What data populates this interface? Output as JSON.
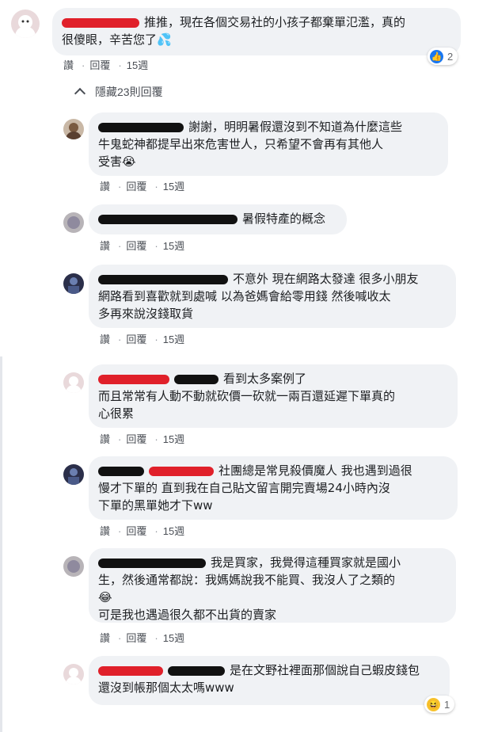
{
  "actions": {
    "like": "讚",
    "reply": "回覆",
    "sep": "·",
    "time": "15週"
  },
  "hidden_replies_label": "隱藏23則回覆",
  "comments": [
    {
      "text": "推推，現在各個交易社的小孩子都棄單氾濫，真的\n很傻眼，辛苦您了💦",
      "reaction_count": "2"
    },
    {
      "text": "謝謝，明明暑假還沒到不知道為什麼這些\n牛鬼蛇神都提早出來危害世人，只希望不會再有其他人\n受害😭"
    },
    {
      "text": "暑假特產的概念"
    },
    {
      "text": "不意外 現在網路太發達 很多小朋友\n網路看到喜歡就到處喊 以為爸媽會給零用錢 然後喊收太\n多再來說沒錢取貨"
    },
    {
      "text": "看到太多案例了\n而且常常有人動不動就砍價一砍就一兩百還延遲下單真的\n心很累"
    },
    {
      "text": "社團總是常見殺價魔人 我也遇到過很\n慢才下單的 直到我在自己貼文留言開完賣場24小時內沒\n下單的黑單她才下ww"
    },
    {
      "text": "我是買家，我覺得這種買家就是國小\n生，然後通常都說：我媽媽說我不能買、我沒人了之類的\n😂\n可是我也遇過很久都不出貨的賣家"
    },
    {
      "text": "是在文野社裡面那個說自己蝦皮錢包\n還沒到帳那個太太嗎www",
      "reaction_count": "1"
    }
  ],
  "colors": {
    "bubble": "#f0f2f5",
    "like": "#1877f2",
    "haha": "#f7c22c",
    "redaction_black": "#111111",
    "redaction_red": "#e0202a"
  },
  "icons": {
    "like": "like-icon",
    "haha": "haha-icon",
    "collapse": "chevron-up-icon"
  }
}
